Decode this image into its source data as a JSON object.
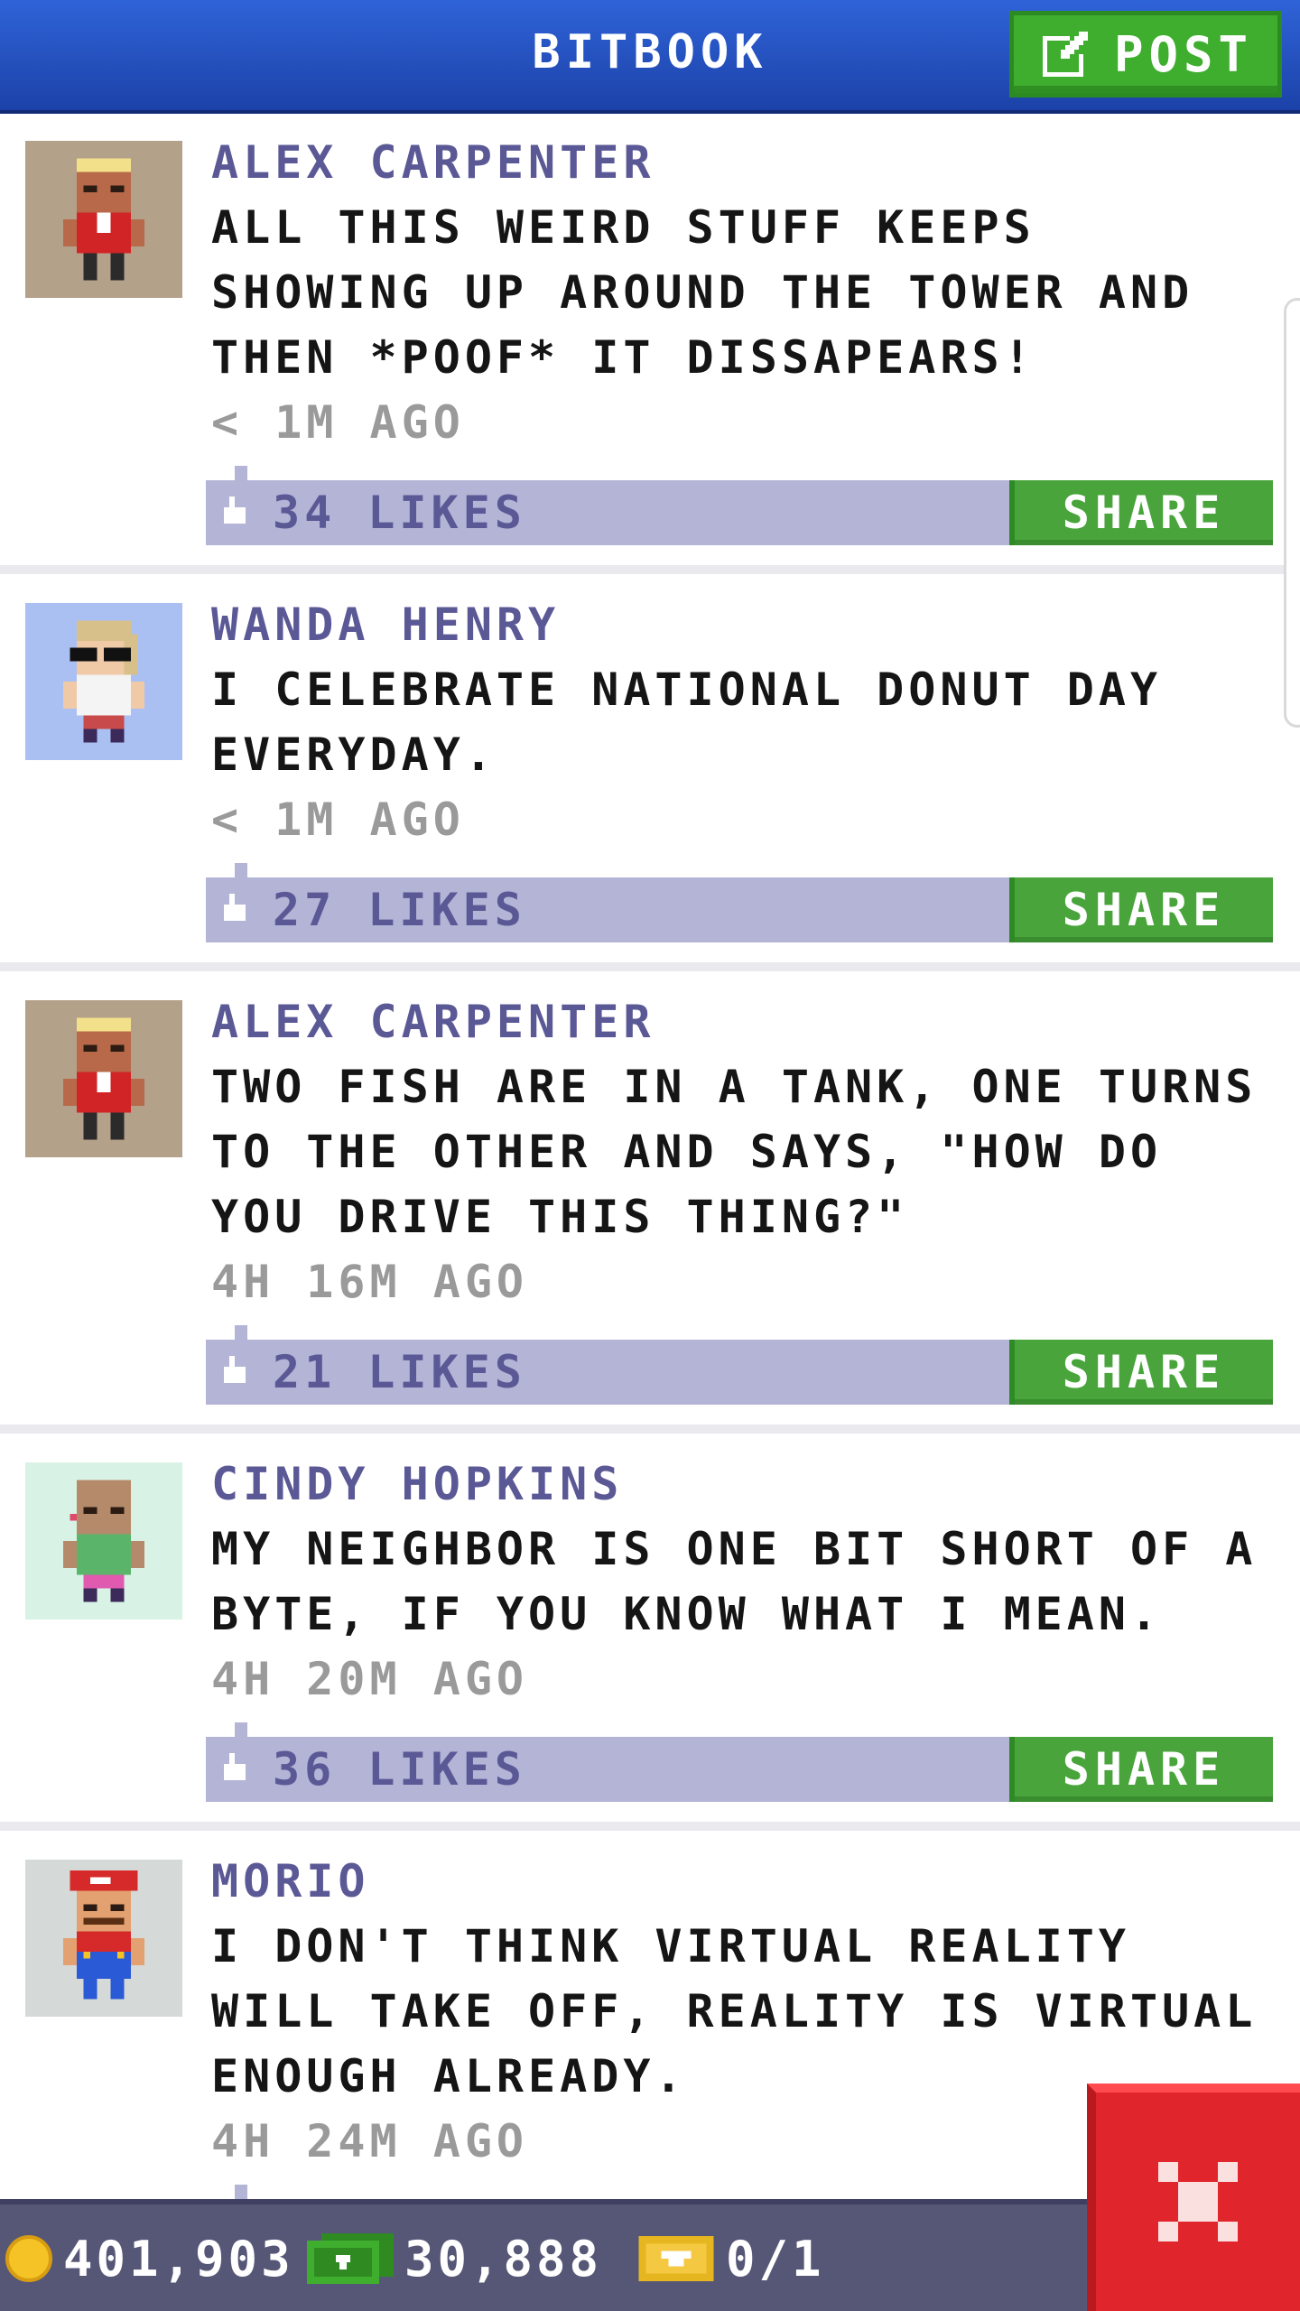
{
  "header": {
    "title": "BITBOOK",
    "post_label": "POST"
  },
  "posts": [
    {
      "author": "ALEX CARPENTER",
      "text": "ALL THIS WEIRD STUFF KEEPS SHOWING UP AROUND THE TOWER AND THEN *POOF* IT DISSAPEARS!",
      "time": "< 1M AGO",
      "likes": "34 LIKES",
      "share_label": "SHARE",
      "avatar_bg": "#b4a18a"
    },
    {
      "author": "WANDA HENRY",
      "text": "I CELEBRATE NATIONAL DONUT DAY EVERYDAY.",
      "time": "< 1M AGO",
      "likes": "27 LIKES",
      "share_label": "SHARE",
      "avatar_bg": "#abc0f2"
    },
    {
      "author": "ALEX CARPENTER",
      "text": "TWO FISH ARE IN A TANK, ONE TURNS TO THE OTHER AND SAYS, \"HOW DO YOU DRIVE THIS THING?\"",
      "time": "4H 16M AGO",
      "likes": "21 LIKES",
      "share_label": "SHARE",
      "avatar_bg": "#b4a18a"
    },
    {
      "author": "CINDY HOPKINS",
      "text": "MY NEIGHBOR IS ONE BIT SHORT OF A BYTE, IF YOU KNOW WHAT I MEAN.",
      "time": "4H 20M AGO",
      "likes": "36 LIKES",
      "share_label": "SHARE",
      "avatar_bg": "#d8f3e6"
    },
    {
      "author": "MORIO",
      "text": "I DON'T THINK VIRTUAL REALITY WILL TAKE OFF, REALITY IS VIRTUAL ENOUGH ALREADY.",
      "time": "4H 24M AGO",
      "avatar_bg": "#d5dad8"
    }
  ],
  "status_bar": {
    "coins": "401,903",
    "bux": "30,888",
    "tickets": "0/1"
  },
  "colors": {
    "header_blue": "#2f63d8",
    "post_green": "#3fae2f",
    "author_purple": "#5b5896",
    "likes_bar": "#b3b4d6",
    "close_red": "#e0262c",
    "bottom_bar": "#565777"
  }
}
